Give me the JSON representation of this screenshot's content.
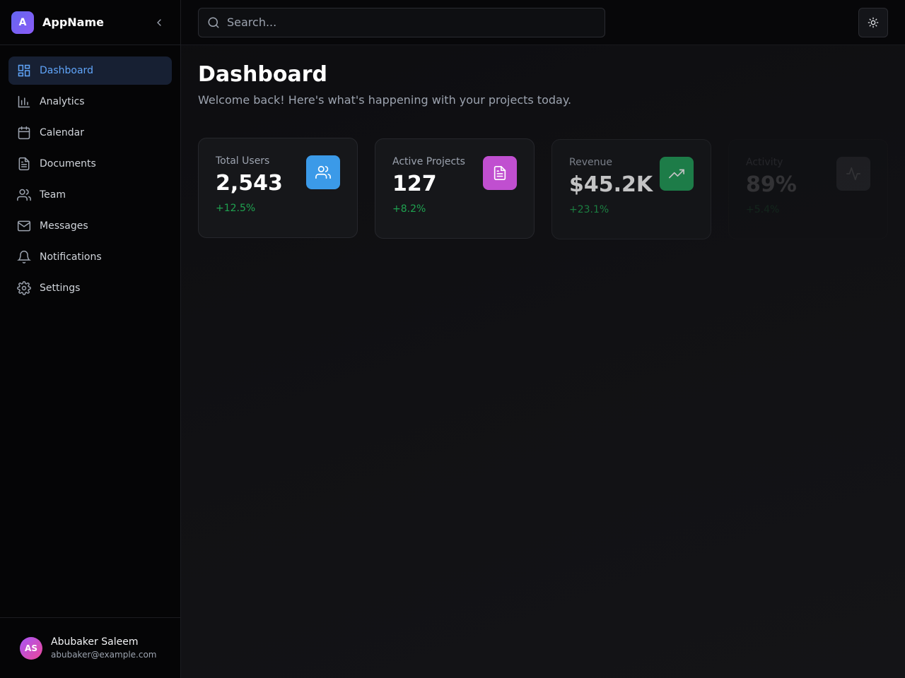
{
  "sidebar": {
    "logo_letter": "A",
    "app_name": "AppName",
    "items": [
      {
        "label": "Dashboard",
        "icon": "dashboard-icon",
        "active": true
      },
      {
        "label": "Analytics",
        "icon": "bar-chart-icon"
      },
      {
        "label": "Calendar",
        "icon": "calendar-icon"
      },
      {
        "label": "Documents",
        "icon": "document-icon"
      },
      {
        "label": "Team",
        "icon": "users-icon"
      },
      {
        "label": "Messages",
        "icon": "mail-icon"
      },
      {
        "label": "Notifications",
        "icon": "bell-icon"
      },
      {
        "label": "Settings",
        "icon": "gear-icon"
      }
    ],
    "user": {
      "initials": "AS",
      "name": "Abubaker Saleem",
      "email": "abubaker@example.com"
    }
  },
  "topbar": {
    "search_placeholder": "Search...",
    "theme_icon": "sun-icon"
  },
  "main": {
    "title": "Dashboard",
    "subtitle": "Welcome back! Here's what's happening with your projects today.",
    "cards": [
      {
        "label": "Total Users",
        "value": "2,543",
        "change": "+12.5%",
        "icon": "users-icon",
        "color": "#3b9ae8"
      },
      {
        "label": "Active Projects",
        "value": "127",
        "change": "+8.2%",
        "icon": "document-icon",
        "color": "#c04fd0"
      },
      {
        "label": "Revenue",
        "value": "$45.2K",
        "change": "+23.1%",
        "icon": "trending-up-icon",
        "color": "#22a05a"
      },
      {
        "label": "Activity",
        "value": "89%",
        "change": "+5.4%",
        "icon": "activity-icon",
        "color": "#6b7280"
      }
    ]
  },
  "colors": {
    "accent": "#60a5fa",
    "positive": "#22c55e"
  }
}
